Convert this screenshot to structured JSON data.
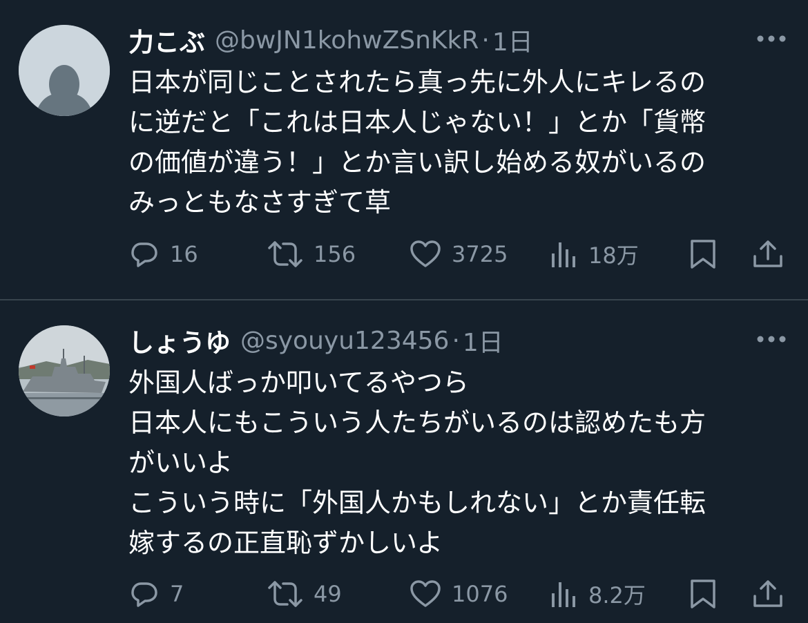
{
  "tweets": [
    {
      "display_name": "力こぶ",
      "handle": "@bwJN1kohwZSnKkR",
      "separator": "·",
      "time": "1日",
      "avatar": "default-profile-avatar",
      "lines": [
        "日本が同じことされたら真っ先に外人にキレるの",
        "に逆だと「これは日本人じゃない！」とか「貨幣",
        "の価値が違う！」とか言い訳し始める奴がいるの",
        "みっともなさすぎて草"
      ],
      "stats": {
        "replies": "16",
        "retweets": "156",
        "likes": "3725",
        "views": "18万"
      }
    },
    {
      "display_name": "しょうゆ",
      "handle": "@syouyu123456",
      "separator": "·",
      "time": "1日",
      "avatar": "warship-photo-avatar",
      "lines": [
        "外国人ばっか叩いてるやつら",
        "日本人にもこういう人たちがいるのは認めたも方",
        "がいいよ",
        "こういう時に「外国人かもしれない」とか責任転",
        "嫁するの正直恥ずかしいよ"
      ],
      "stats": {
        "replies": "7",
        "retweets": "49",
        "likes": "1076",
        "views": "8.2万"
      }
    }
  ],
  "colors": {
    "background": "#15202b",
    "text_primary": "#ffffff",
    "text_secondary": "#8b98a5",
    "divider": "#38444d"
  },
  "icons": {
    "more": "more-horizontal-icon",
    "reply": "reply-icon",
    "retweet": "retweet-icon",
    "like": "heart-icon",
    "views": "views-icon",
    "bookmark": "bookmark-icon",
    "share": "share-icon"
  }
}
